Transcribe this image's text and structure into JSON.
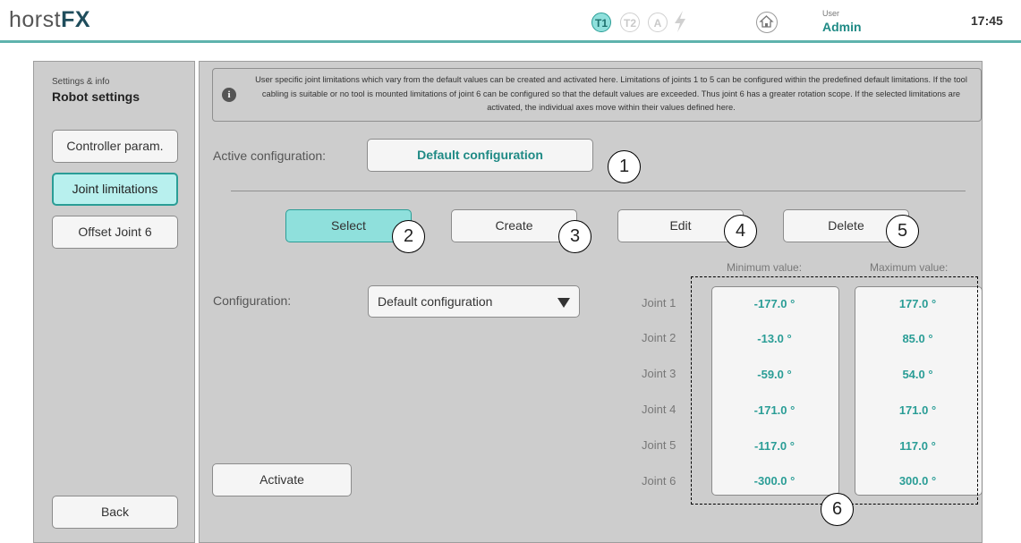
{
  "header": {
    "logo_text": "horst",
    "logo_bold": "FX",
    "modes": [
      {
        "label": "T1",
        "state": "active"
      },
      {
        "label": "T2",
        "state": "inactive"
      },
      {
        "label": "A",
        "state": "inactive"
      }
    ],
    "user_caption": "User",
    "user_name": "Admin",
    "time": "17:45",
    "accent_color": "#2a9d96"
  },
  "sidebar": {
    "caption": "Settings & info",
    "title": "Robot settings",
    "items": [
      {
        "label": "Controller param.",
        "active": false
      },
      {
        "label": "Joint limitations",
        "active": true
      },
      {
        "label": "Offset Joint 6",
        "active": false
      }
    ],
    "back_label": "Back"
  },
  "main": {
    "info_text": "User specific joint limitations which vary from the default values can be created and activated here. Limitations of joints 1 to 5 can be configured within the predefined default limitations. If the tool cabling is suitable or no tool is mounted limitations of joint 6 can be configured so that the default values are exceeded. Thus joint 6 has a greater rotation scope. If the selected limitations are activated, the individual axes move within their values defined here.",
    "active_config_label": "Active configuration:",
    "active_config_value": "Default configuration",
    "actions": {
      "select": "Select",
      "create": "Create",
      "edit": "Edit",
      "delete": "Delete"
    },
    "configuration_label": "Configuration:",
    "configuration_value": "Default configuration",
    "activate_label": "Activate",
    "min_header": "Minimum value:",
    "max_header": "Maximum value:",
    "joints": [
      {
        "name": "Joint 1",
        "min": "-177.0 °",
        "max": "177.0 °"
      },
      {
        "name": "Joint 2",
        "min": "-13.0 °",
        "max": "85.0 °"
      },
      {
        "name": "Joint 3",
        "min": "-59.0 °",
        "max": "54.0 °"
      },
      {
        "name": "Joint 4",
        "min": "-171.0 °",
        "max": "171.0 °"
      },
      {
        "name": "Joint 5",
        "min": "-117.0 °",
        "max": "117.0 °"
      },
      {
        "name": "Joint 6",
        "min": "-300.0 °",
        "max": "300.0 °"
      }
    ]
  },
  "callouts": [
    "1",
    "2",
    "3",
    "4",
    "5",
    "6"
  ]
}
